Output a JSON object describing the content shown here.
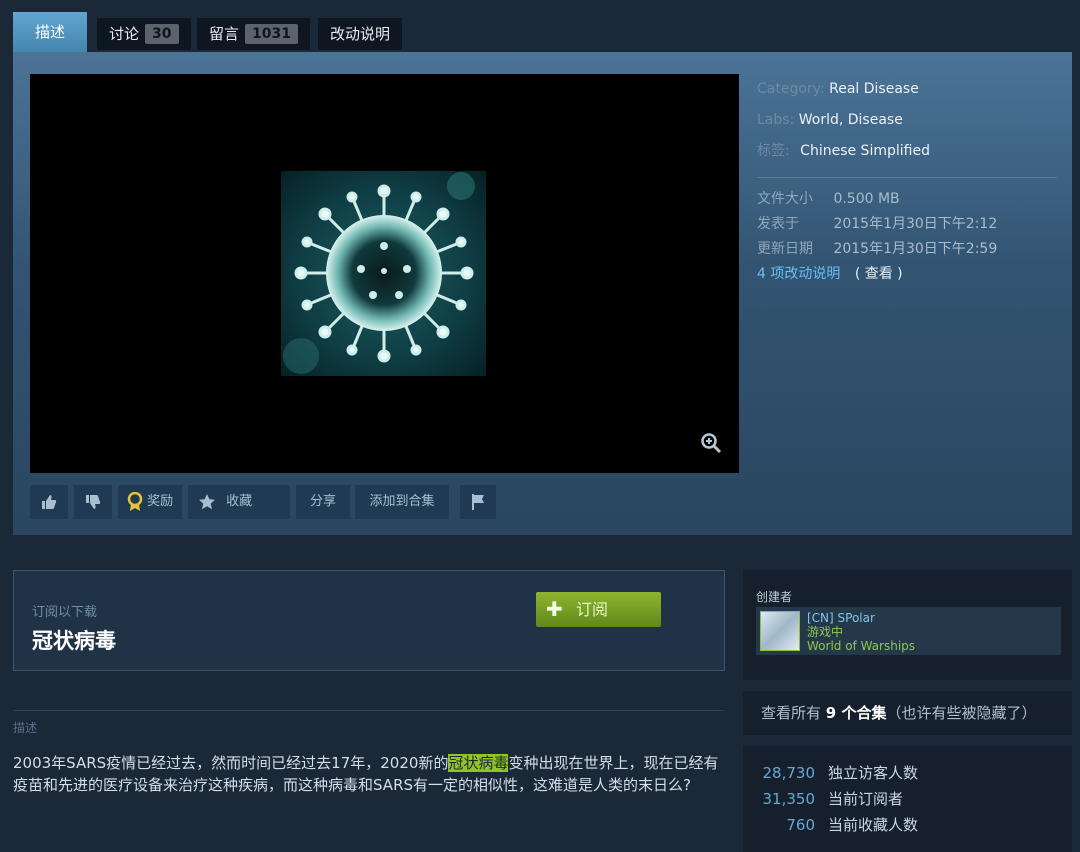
{
  "tabs": [
    {
      "label": "描述",
      "count": null
    },
    {
      "label": "讨论",
      "count": "30"
    },
    {
      "label": "留言",
      "count": "1031"
    },
    {
      "label": "改动说明",
      "count": null
    }
  ],
  "actions": {
    "award": "奖励",
    "favorite": "收藏",
    "share": "分享",
    "add_to_collection": "添加到合集"
  },
  "meta": {
    "category_label": "Category:",
    "category_value": "Real Disease",
    "labs_label": "Labs:",
    "labs_values": [
      "World",
      "Disease"
    ],
    "tags_label": "标签:",
    "tags_value": "Chinese Simplified",
    "file_size_label": "文件大小",
    "file_size_value": "0.500 MB",
    "posted_label": "发表于",
    "posted_value": "2015年1月30日下午2:12",
    "updated_label": "更新日期",
    "updated_value": "2015年1月30日下午2:59",
    "changes_link": "4 项改动说明",
    "changes_view": "( 查看 )"
  },
  "subscribe": {
    "hint": "订阅以下载",
    "title": "冠状病毒",
    "button": "订阅"
  },
  "description": {
    "heading": "描述",
    "before": "2003年SARS疫情已经过去，然而时间已经过去17年，2020新的",
    "highlight": "冠状病毒",
    "after": "变种出现在世界上，现在已经有疫苗和先进的医疗设备来治疗这种疾病，而这种病毒和SARS有一定的相似性，这难道是人类的末日么?"
  },
  "creator": {
    "label": "创建者",
    "name": "[CN] SPolar",
    "status": "游戏中",
    "game": "World of Warships"
  },
  "collections": {
    "prefix": "查看所有 ",
    "count": "9",
    "mid": " 个合集",
    "suffix": "（也许有些被隐藏了）"
  },
  "stats": [
    {
      "value": "28,730",
      "label": "独立访客人数"
    },
    {
      "value": "31,350",
      "label": "当前订阅者"
    },
    {
      "value": "760",
      "label": "当前收藏人数"
    }
  ],
  "colors": {
    "page_bg": "#1b2838",
    "accent_blue": "#66c0f4",
    "subscribe_green": "#75a325",
    "highlight": "#91c523"
  }
}
